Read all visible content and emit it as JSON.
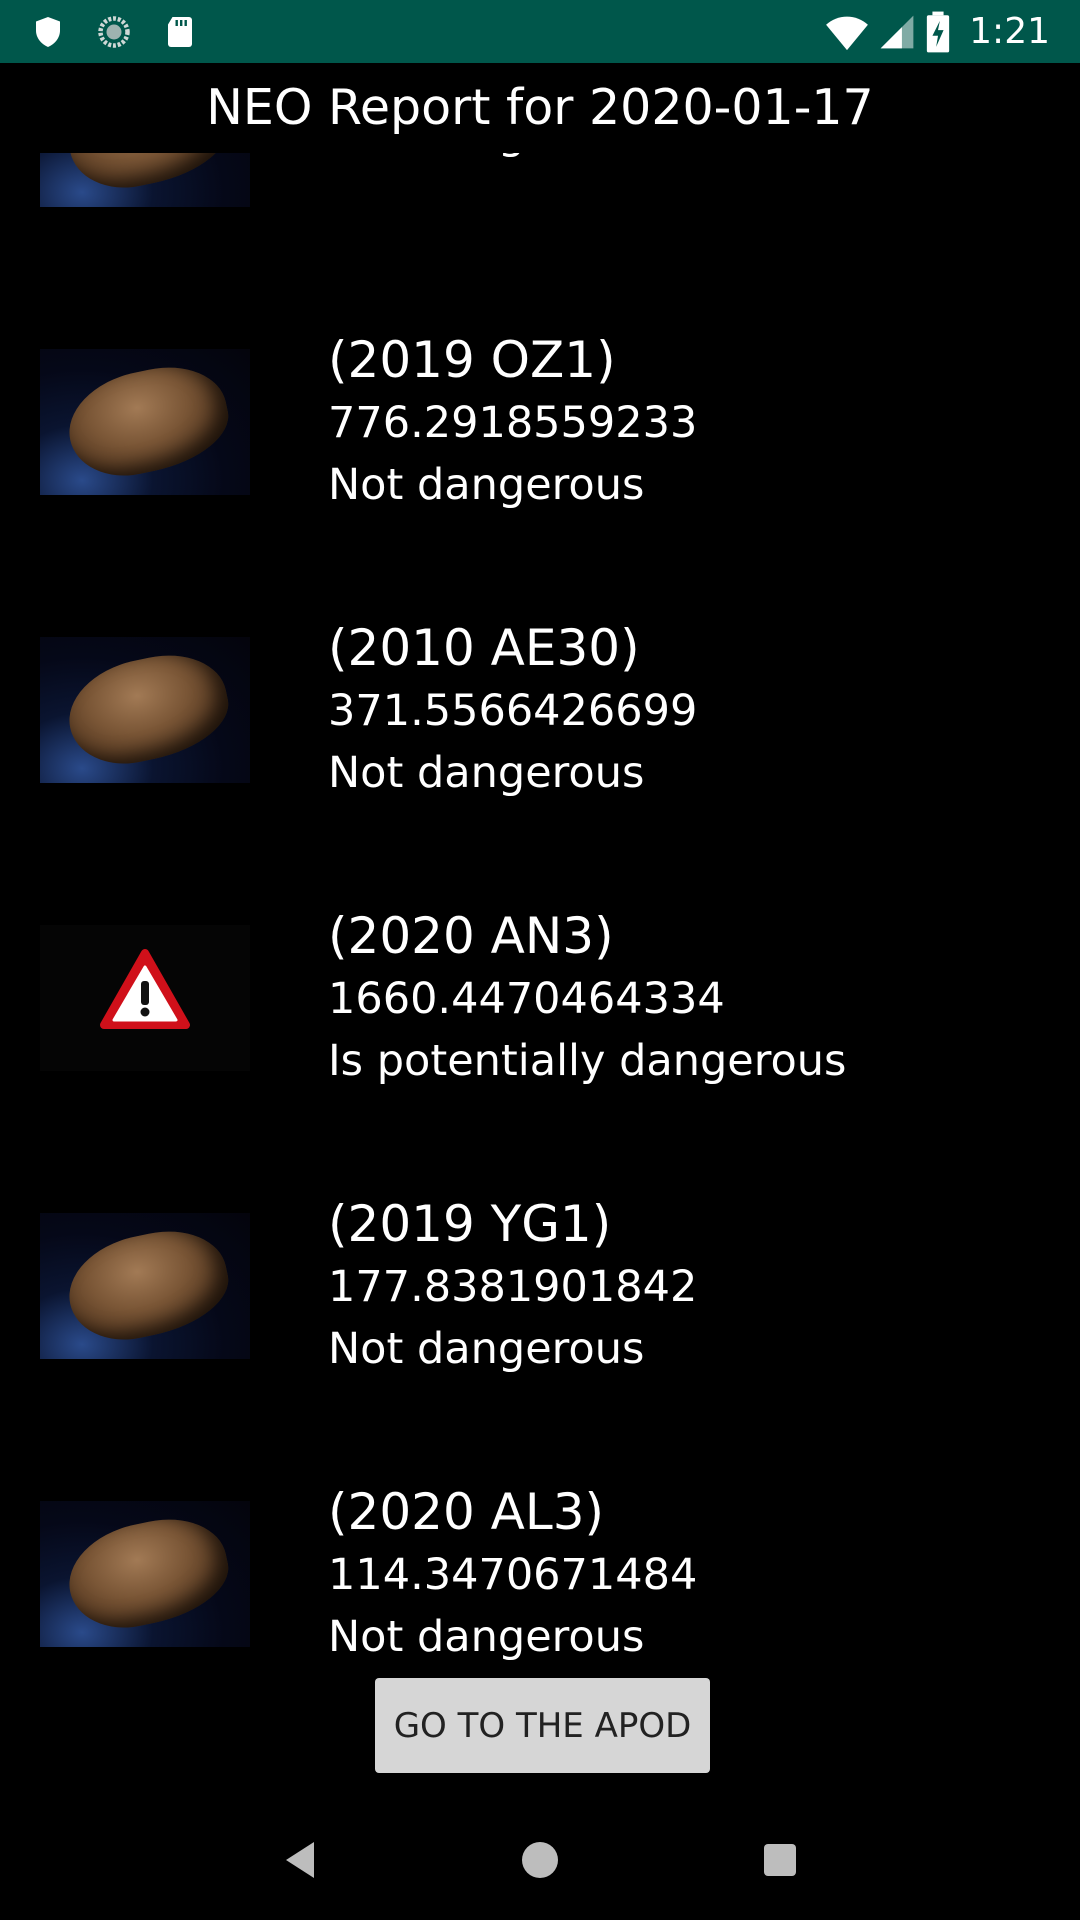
{
  "status_bar": {
    "time": "1:21",
    "icons_left": [
      "shield-icon",
      "sync-icon",
      "sd-card-icon"
    ],
    "icons_right": [
      "wifi-icon",
      "cell-signal-icon",
      "battery-charging-icon"
    ]
  },
  "header": {
    "title": "NEO Report for 2020-01-17"
  },
  "neo_list": {
    "items": [
      {
        "name": "",
        "value": "",
        "status": "Not dangerous",
        "icon": "asteroid-image"
      },
      {
        "name": "(2019 OZ1)",
        "value": "776.2918559233",
        "status": "Not dangerous",
        "icon": "asteroid-image"
      },
      {
        "name": "(2010 AE30)",
        "value": "371.5566426699",
        "status": "Not dangerous",
        "icon": "asteroid-image"
      },
      {
        "name": "(2020 AN3)",
        "value": "1660.4470464334",
        "status": "Is potentially dangerous",
        "icon": "warning-icon"
      },
      {
        "name": "(2019 YG1)",
        "value": "177.8381901842",
        "status": "Not dangerous",
        "icon": "asteroid-image"
      },
      {
        "name": "(2020 AL3)",
        "value": "114.3470671484",
        "status": "Not dangerous",
        "icon": "asteroid-image"
      }
    ]
  },
  "actions": {
    "apod_button_label": "GO TO THE APOD"
  },
  "nav_bar": {
    "buttons": [
      "back-icon",
      "home-icon",
      "recents-icon"
    ]
  },
  "colors": {
    "status_bar_bg": "#00574b",
    "background": "#000000",
    "button_bg": "#d6d6d6",
    "warning_red": "#d0101a"
  }
}
